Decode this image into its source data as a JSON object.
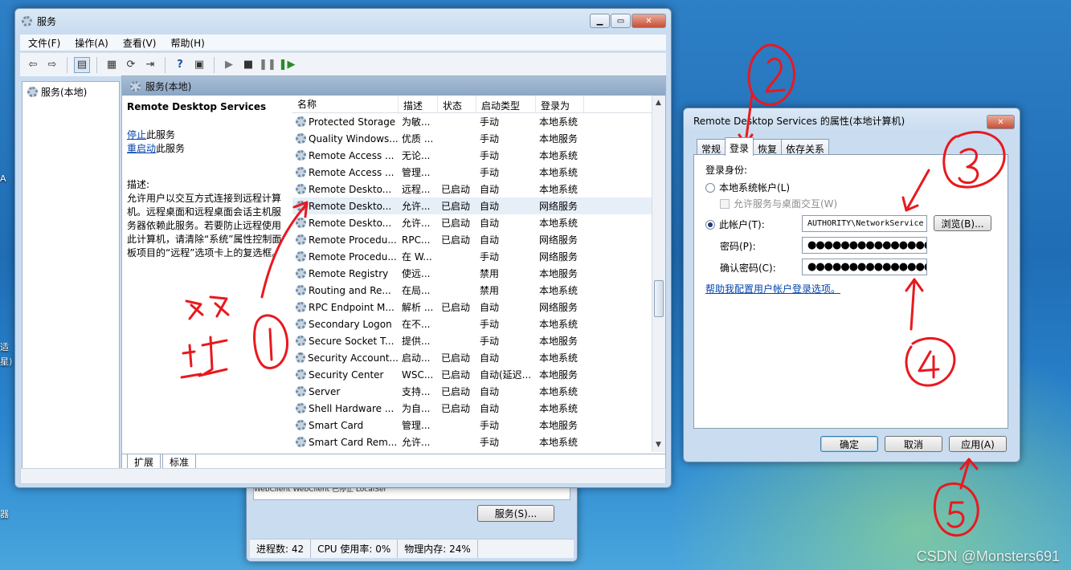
{
  "desktop": {
    "labels": [
      {
        "text": "A"
      },
      {
        "text": "适"
      },
      {
        "text": "星)"
      },
      {
        "text": "器"
      }
    ],
    "watermark": "CSDN @Monsters691"
  },
  "services_window": {
    "title": "服务",
    "menu": [
      "文件(F)",
      "操作(A)",
      "查看(V)",
      "帮助(H)"
    ],
    "tree_root": "服务(本地)",
    "pane_header": "服务(本地)",
    "detail": {
      "service_name": "Remote Desktop Services",
      "stop_link": "停止",
      "stop_suffix": "此服务",
      "restart_link": "重启动",
      "restart_suffix": "此服务",
      "desc_label": "描述:",
      "desc_text": "允许用户以交互方式连接到远程计算机。远程桌面和远程桌面会话主机服务器依赖此服务。若要防止远程使用此计算机，请清除“系统”属性控制面板项目的“远程”选项卡上的复选框。"
    },
    "columns": [
      "名称",
      "描述",
      "状态",
      "启动类型",
      "登录为"
    ],
    "rows": [
      {
        "name": "Protected Storage",
        "desc": "为敏...",
        "status": "",
        "startup": "手动",
        "logon": "本地系统"
      },
      {
        "name": "Quality Windows...",
        "desc": "优质 ...",
        "status": "",
        "startup": "手动",
        "logon": "本地服务"
      },
      {
        "name": "Remote Access ...",
        "desc": "无论...",
        "status": "",
        "startup": "手动",
        "logon": "本地系统"
      },
      {
        "name": "Remote Access ...",
        "desc": "管理...",
        "status": "",
        "startup": "手动",
        "logon": "本地系统"
      },
      {
        "name": "Remote Deskto...",
        "desc": "远程...",
        "status": "已启动",
        "startup": "自动",
        "logon": "本地系统"
      },
      {
        "name": "Remote Deskto...",
        "desc": "允许...",
        "status": "已启动",
        "startup": "自动",
        "logon": "网络服务"
      },
      {
        "name": "Remote Deskto...",
        "desc": "允许...",
        "status": "已启动",
        "startup": "自动",
        "logon": "本地系统"
      },
      {
        "name": "Remote Procedu...",
        "desc": "RPC...",
        "status": "已启动",
        "startup": "自动",
        "logon": "网络服务"
      },
      {
        "name": "Remote Procedu...",
        "desc": "在 W...",
        "status": "",
        "startup": "手动",
        "logon": "网络服务"
      },
      {
        "name": "Remote Registry",
        "desc": "使远...",
        "status": "",
        "startup": "禁用",
        "logon": "本地服务"
      },
      {
        "name": "Routing and Re...",
        "desc": "在局...",
        "status": "",
        "startup": "禁用",
        "logon": "本地系统"
      },
      {
        "name": "RPC Endpoint M...",
        "desc": "解析 ...",
        "status": "已启动",
        "startup": "自动",
        "logon": "网络服务"
      },
      {
        "name": "Secondary Logon",
        "desc": "在不...",
        "status": "",
        "startup": "手动",
        "logon": "本地系统"
      },
      {
        "name": "Secure Socket T...",
        "desc": "提供...",
        "status": "",
        "startup": "手动",
        "logon": "本地服务"
      },
      {
        "name": "Security Account...",
        "desc": "启动...",
        "status": "已启动",
        "startup": "自动",
        "logon": "本地系统"
      },
      {
        "name": "Security Center",
        "desc": "WSC...",
        "status": "已启动",
        "startup": "自动(延迟...",
        "logon": "本地服务"
      },
      {
        "name": "Server",
        "desc": "支持...",
        "status": "已启动",
        "startup": "自动",
        "logon": "本地系统"
      },
      {
        "name": "Shell Hardware ...",
        "desc": "为自...",
        "status": "已启动",
        "startup": "自动",
        "logon": "本地系统"
      },
      {
        "name": "Smart Card",
        "desc": "管理...",
        "status": "",
        "startup": "手动",
        "logon": "本地服务"
      },
      {
        "name": "Smart Card Rem...",
        "desc": "允许...",
        "status": "",
        "startup": "手动",
        "logon": "本地系统"
      }
    ],
    "selected_row": 5,
    "bottom_tabs": [
      "扩展",
      "标准"
    ]
  },
  "task_manager": {
    "hidden_row": "WebClient        WebClient        已停止    LocalSer",
    "services_button": "服务(S)...",
    "status": [
      "进程数: 42",
      "CPU 使用率: 0%",
      "物理内存: 24%"
    ]
  },
  "properties_dialog": {
    "title": "Remote Desktop Services 的属性(本地计算机)",
    "tabs": [
      "常规",
      "登录",
      "恢复",
      "依存关系"
    ],
    "active_tab": "登录",
    "logon_as_label": "登录身份:",
    "local_system_label": "本地系统帐户(L)",
    "allow_desktop_label": "允许服务与桌面交互(W)",
    "this_account_label": "此帐户(T):",
    "account_value": "AUTHORITY\\NetworkService",
    "browse_button": "浏览(B)...",
    "password_label": "密码(P):",
    "password_value": "●●●●●●●●●●●●●●●",
    "confirm_label": "确认密码(C):",
    "confirm_value": "●●●●●●●●●●●●●●●",
    "help_link": "帮助我配置用户帐户登录选项。",
    "ok_button": "确定",
    "cancel_button": "取消",
    "apply_button": "应用(A)"
  },
  "annotation_colors": {
    "ink": "#e8191f"
  }
}
